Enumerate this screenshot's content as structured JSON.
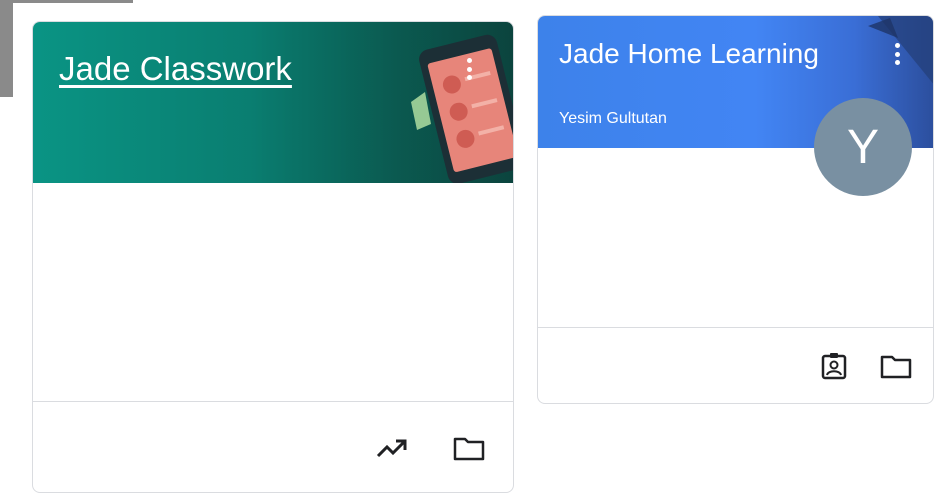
{
  "classes": [
    {
      "title": "Jade Classwork",
      "teacher": "",
      "banner_color": "#0a9484",
      "icons": [
        "more-vert-icon",
        "trending-up-icon",
        "folder-icon"
      ]
    },
    {
      "title": "Jade Home Learning",
      "teacher": "Yesim Gultutan",
      "avatar_letter": "Y",
      "banner_color": "#4285f4",
      "avatar_color": "#7990a2",
      "icons": [
        "more-vert-icon",
        "assignment-ind-icon",
        "folder-icon"
      ]
    }
  ]
}
